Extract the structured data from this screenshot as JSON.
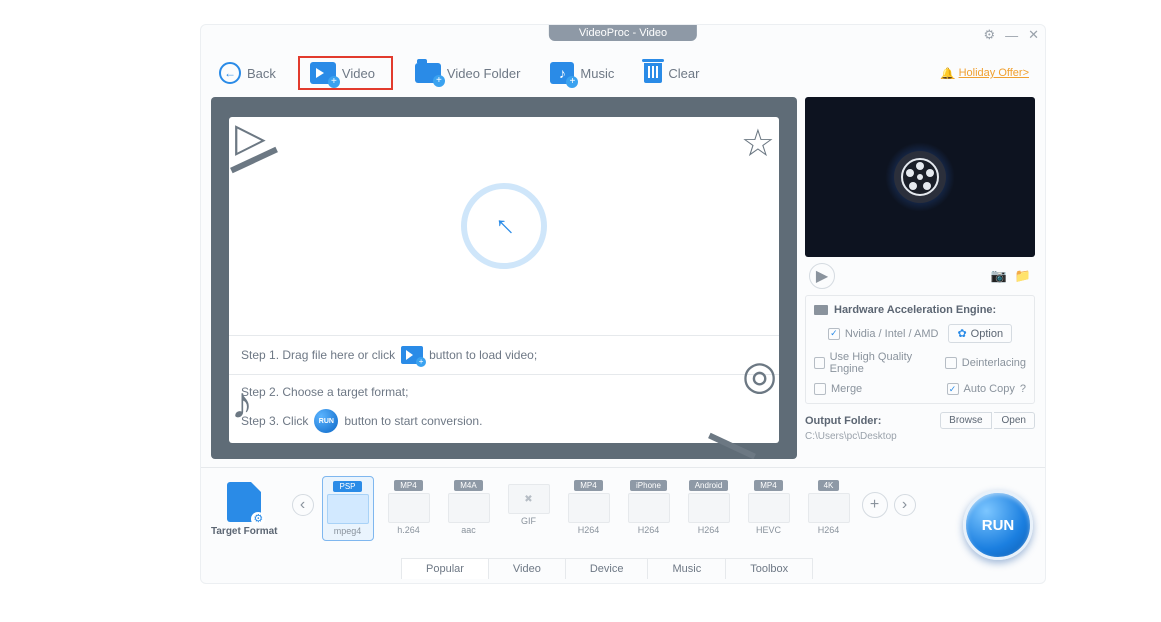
{
  "title": "VideoProc - Video",
  "toolbar": {
    "back": "Back",
    "video": "Video",
    "videoFolder": "Video Folder",
    "music": "Music",
    "clear": "Clear",
    "holiday": "Holiday Offer>"
  },
  "drop": {
    "step1a": "Step 1. Drag file here or click",
    "step1b": "button to load video;",
    "step2": "Step 2. Choose a target format;",
    "step3a": "Step 3. Click",
    "step3b": "button to start conversion.",
    "runMini": "RUN"
  },
  "hw": {
    "title": "Hardware Acceleration Engine:",
    "nvidia": "Nvidia / Intel / AMD",
    "option": "Option",
    "hq": "Use High Quality Engine",
    "deint": "Deinterlacing",
    "merge": "Merge",
    "autocopy": "Auto Copy",
    "q": "?"
  },
  "outFolder": {
    "label": "Output Folder:",
    "browse": "Browse",
    "open": "Open",
    "path": "C:\\Users\\pc\\Desktop"
  },
  "targetFormat": "Target Format",
  "formats": [
    {
      "badge": "PSP",
      "sub": "mpeg4",
      "sel": true
    },
    {
      "badge": "MP4",
      "sub": "h.264"
    },
    {
      "badge": "M4A",
      "sub": "aac"
    },
    {
      "badge": "",
      "sub": "GIF",
      "tool": true
    },
    {
      "badge": "MP4",
      "sub": "H264"
    },
    {
      "badge": "iPhone",
      "sub": "H264"
    },
    {
      "badge": "Android",
      "sub": "H264"
    },
    {
      "badge": "MP4",
      "sub": "HEVC"
    },
    {
      "badge": "4K",
      "sub": "H264"
    }
  ],
  "tabs": [
    "Popular",
    "Video",
    "Device",
    "Music",
    "Toolbox"
  ],
  "run": "RUN"
}
